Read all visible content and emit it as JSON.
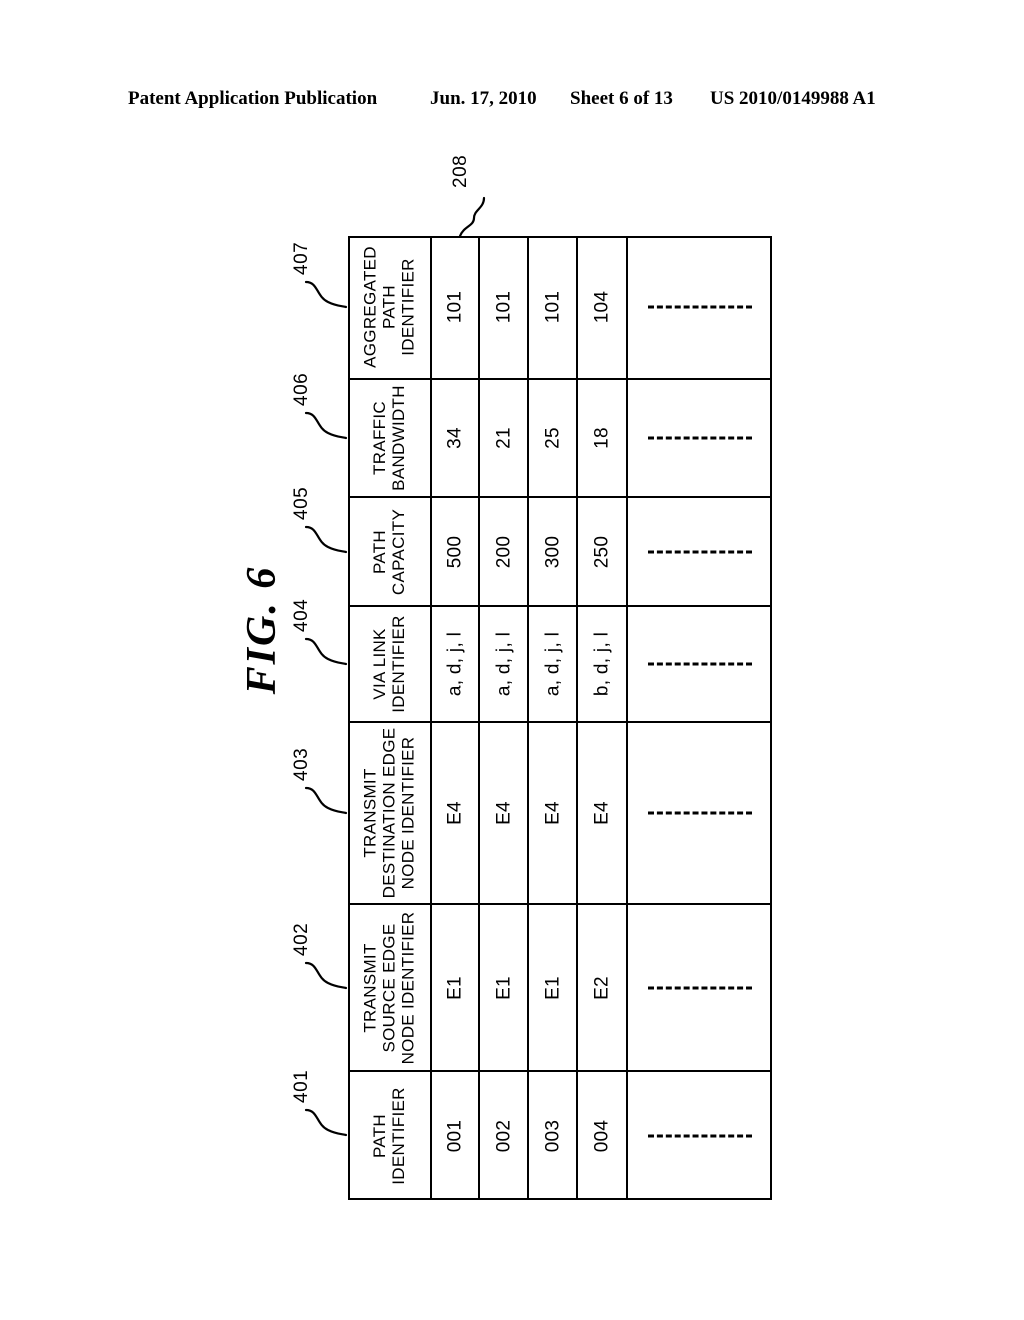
{
  "header": {
    "publication": "Patent Application Publication",
    "date": "Jun. 17, 2010",
    "sheet": "Sheet 6 of 13",
    "patent_number": "US 2010/0149988 A1"
  },
  "figure": {
    "label": "FIG. 6",
    "table_reference": "208"
  },
  "table": {
    "reference": "208",
    "ellipsis_label": "------------",
    "fields": [
      {
        "ref": "407",
        "label": "AGGREGATED\nPATH\nIDENTIFIER",
        "lines": [
          "AGGREGATED",
          "PATH",
          "IDENTIFIER"
        ]
      },
      {
        "ref": "406",
        "label": "TRAFFIC\nBANDWIDTH",
        "lines": [
          "TRAFFIC",
          "BANDWIDTH"
        ]
      },
      {
        "ref": "405",
        "label": "PATH\nCAPACITY",
        "lines": [
          "PATH",
          "CAPACITY"
        ]
      },
      {
        "ref": "404",
        "label": "VIA LINK\nIDENTIFIER",
        "lines": [
          "VIA LINK",
          "IDENTIFIER"
        ]
      },
      {
        "ref": "403",
        "label": "TRANSMIT\nDESTINATION EDGE\nNODE IDENTIFIER",
        "lines": [
          "TRANSMIT",
          "DESTINATION EDGE",
          "NODE IDENTIFIER"
        ]
      },
      {
        "ref": "402",
        "label": "TRANSMIT\nSOURCE EDGE\nNODE IDENTIFIER",
        "lines": [
          "TRANSMIT",
          "SOURCE EDGE",
          "NODE IDENTIFIER"
        ]
      },
      {
        "ref": "401",
        "label": "PATH\nIDENTIFIER",
        "lines": [
          "PATH",
          "IDENTIFIER"
        ]
      }
    ],
    "records": [
      {
        "path_identifier": "001",
        "transmit_source_edge_node_identifier": "E1",
        "transmit_destination_edge_node_identifier": "E4",
        "via_link_identifier": "a, d, j, l",
        "path_capacity": "500",
        "traffic_bandwidth": "34",
        "aggregated_path_identifier": "101"
      },
      {
        "path_identifier": "002",
        "transmit_source_edge_node_identifier": "E1",
        "transmit_destination_edge_node_identifier": "E4",
        "via_link_identifier": "a, d, j, l",
        "path_capacity": "200",
        "traffic_bandwidth": "21",
        "aggregated_path_identifier": "101"
      },
      {
        "path_identifier": "003",
        "transmit_source_edge_node_identifier": "E1",
        "transmit_destination_edge_node_identifier": "E4",
        "via_link_identifier": "a, d, j, l",
        "path_capacity": "300",
        "traffic_bandwidth": "25",
        "aggregated_path_identifier": "101"
      },
      {
        "path_identifier": "004",
        "transmit_source_edge_node_identifier": "E2",
        "transmit_destination_edge_node_identifier": "E4",
        "via_link_identifier": "b, d, j, l",
        "path_capacity": "250",
        "traffic_bandwidth": "18",
        "aggregated_path_identifier": "104"
      }
    ]
  }
}
